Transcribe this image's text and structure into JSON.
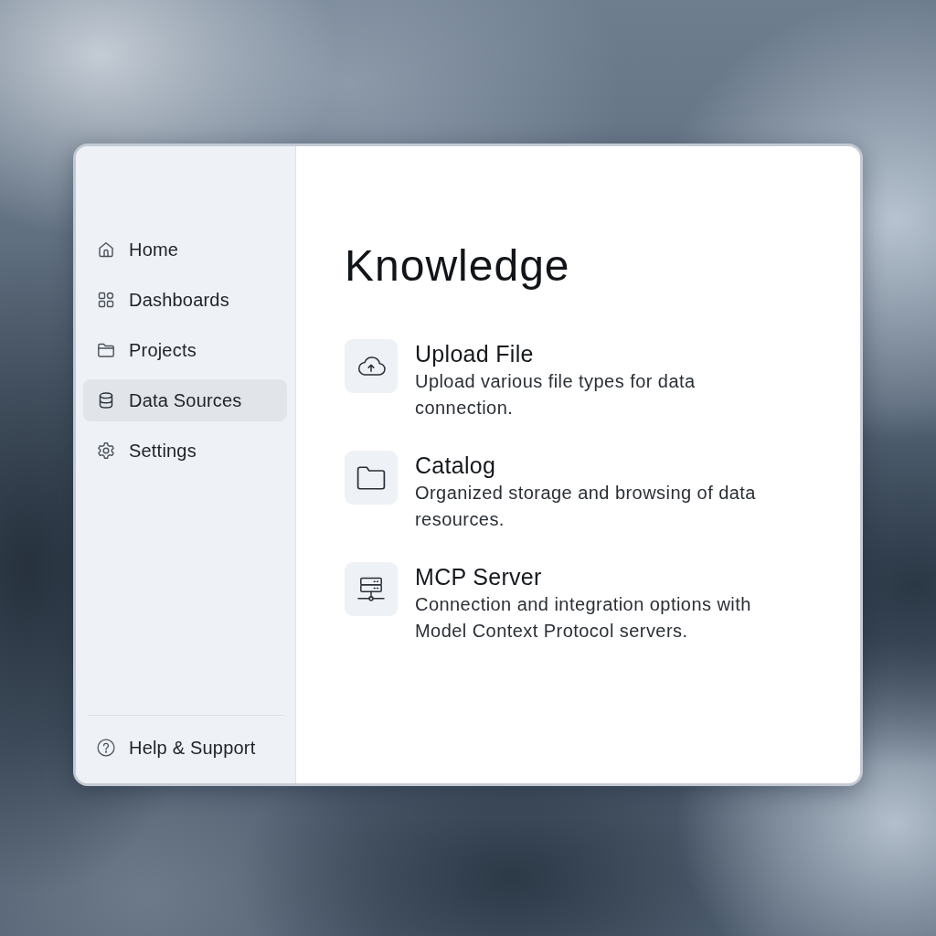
{
  "sidebar": {
    "items": [
      {
        "label": "Home",
        "selected": false
      },
      {
        "label": "Dashboards",
        "selected": false
      },
      {
        "label": "Projects",
        "selected": false
      },
      {
        "label": "Data Sources",
        "selected": true
      },
      {
        "label": "Settings",
        "selected": false
      }
    ],
    "footer_item": {
      "label": "Help & Support"
    }
  },
  "main": {
    "title": "Knowledge",
    "options": [
      {
        "title": "Upload File",
        "description": "Upload various file types for data connection."
      },
      {
        "title": "Catalog",
        "description": "Organized storage and browsing of data resources."
      },
      {
        "title": "MCP Server",
        "description": "Connection and integration options with Model Context Protocol servers."
      }
    ]
  }
}
